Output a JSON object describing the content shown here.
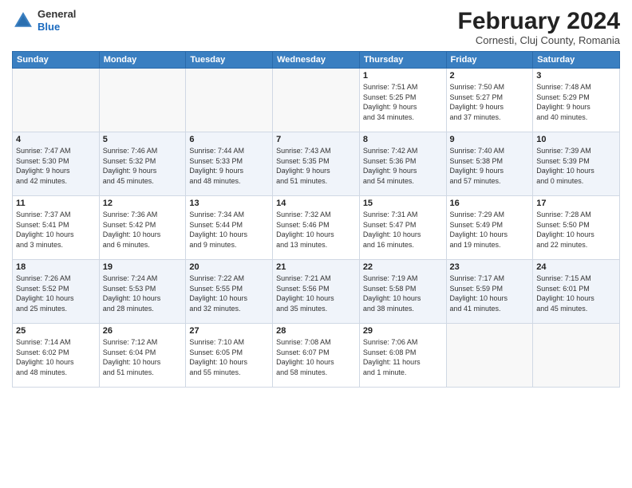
{
  "header": {
    "logo_line1": "General",
    "logo_line2": "Blue",
    "month_title": "February 2024",
    "subtitle": "Cornesti, Cluj County, Romania"
  },
  "days_of_week": [
    "Sunday",
    "Monday",
    "Tuesday",
    "Wednesday",
    "Thursday",
    "Friday",
    "Saturday"
  ],
  "weeks": [
    [
      {
        "day": "",
        "detail": ""
      },
      {
        "day": "",
        "detail": ""
      },
      {
        "day": "",
        "detail": ""
      },
      {
        "day": "",
        "detail": ""
      },
      {
        "day": "1",
        "detail": "Sunrise: 7:51 AM\nSunset: 5:25 PM\nDaylight: 9 hours\nand 34 minutes."
      },
      {
        "day": "2",
        "detail": "Sunrise: 7:50 AM\nSunset: 5:27 PM\nDaylight: 9 hours\nand 37 minutes."
      },
      {
        "day": "3",
        "detail": "Sunrise: 7:48 AM\nSunset: 5:29 PM\nDaylight: 9 hours\nand 40 minutes."
      }
    ],
    [
      {
        "day": "4",
        "detail": "Sunrise: 7:47 AM\nSunset: 5:30 PM\nDaylight: 9 hours\nand 42 minutes."
      },
      {
        "day": "5",
        "detail": "Sunrise: 7:46 AM\nSunset: 5:32 PM\nDaylight: 9 hours\nand 45 minutes."
      },
      {
        "day": "6",
        "detail": "Sunrise: 7:44 AM\nSunset: 5:33 PM\nDaylight: 9 hours\nand 48 minutes."
      },
      {
        "day": "7",
        "detail": "Sunrise: 7:43 AM\nSunset: 5:35 PM\nDaylight: 9 hours\nand 51 minutes."
      },
      {
        "day": "8",
        "detail": "Sunrise: 7:42 AM\nSunset: 5:36 PM\nDaylight: 9 hours\nand 54 minutes."
      },
      {
        "day": "9",
        "detail": "Sunrise: 7:40 AM\nSunset: 5:38 PM\nDaylight: 9 hours\nand 57 minutes."
      },
      {
        "day": "10",
        "detail": "Sunrise: 7:39 AM\nSunset: 5:39 PM\nDaylight: 10 hours\nand 0 minutes."
      }
    ],
    [
      {
        "day": "11",
        "detail": "Sunrise: 7:37 AM\nSunset: 5:41 PM\nDaylight: 10 hours\nand 3 minutes."
      },
      {
        "day": "12",
        "detail": "Sunrise: 7:36 AM\nSunset: 5:42 PM\nDaylight: 10 hours\nand 6 minutes."
      },
      {
        "day": "13",
        "detail": "Sunrise: 7:34 AM\nSunset: 5:44 PM\nDaylight: 10 hours\nand 9 minutes."
      },
      {
        "day": "14",
        "detail": "Sunrise: 7:32 AM\nSunset: 5:46 PM\nDaylight: 10 hours\nand 13 minutes."
      },
      {
        "day": "15",
        "detail": "Sunrise: 7:31 AM\nSunset: 5:47 PM\nDaylight: 10 hours\nand 16 minutes."
      },
      {
        "day": "16",
        "detail": "Sunrise: 7:29 AM\nSunset: 5:49 PM\nDaylight: 10 hours\nand 19 minutes."
      },
      {
        "day": "17",
        "detail": "Sunrise: 7:28 AM\nSunset: 5:50 PM\nDaylight: 10 hours\nand 22 minutes."
      }
    ],
    [
      {
        "day": "18",
        "detail": "Sunrise: 7:26 AM\nSunset: 5:52 PM\nDaylight: 10 hours\nand 25 minutes."
      },
      {
        "day": "19",
        "detail": "Sunrise: 7:24 AM\nSunset: 5:53 PM\nDaylight: 10 hours\nand 28 minutes."
      },
      {
        "day": "20",
        "detail": "Sunrise: 7:22 AM\nSunset: 5:55 PM\nDaylight: 10 hours\nand 32 minutes."
      },
      {
        "day": "21",
        "detail": "Sunrise: 7:21 AM\nSunset: 5:56 PM\nDaylight: 10 hours\nand 35 minutes."
      },
      {
        "day": "22",
        "detail": "Sunrise: 7:19 AM\nSunset: 5:58 PM\nDaylight: 10 hours\nand 38 minutes."
      },
      {
        "day": "23",
        "detail": "Sunrise: 7:17 AM\nSunset: 5:59 PM\nDaylight: 10 hours\nand 41 minutes."
      },
      {
        "day": "24",
        "detail": "Sunrise: 7:15 AM\nSunset: 6:01 PM\nDaylight: 10 hours\nand 45 minutes."
      }
    ],
    [
      {
        "day": "25",
        "detail": "Sunrise: 7:14 AM\nSunset: 6:02 PM\nDaylight: 10 hours\nand 48 minutes."
      },
      {
        "day": "26",
        "detail": "Sunrise: 7:12 AM\nSunset: 6:04 PM\nDaylight: 10 hours\nand 51 minutes."
      },
      {
        "day": "27",
        "detail": "Sunrise: 7:10 AM\nSunset: 6:05 PM\nDaylight: 10 hours\nand 55 minutes."
      },
      {
        "day": "28",
        "detail": "Sunrise: 7:08 AM\nSunset: 6:07 PM\nDaylight: 10 hours\nand 58 minutes."
      },
      {
        "day": "29",
        "detail": "Sunrise: 7:06 AM\nSunset: 6:08 PM\nDaylight: 11 hours\nand 1 minute."
      },
      {
        "day": "",
        "detail": ""
      },
      {
        "day": "",
        "detail": ""
      }
    ]
  ]
}
